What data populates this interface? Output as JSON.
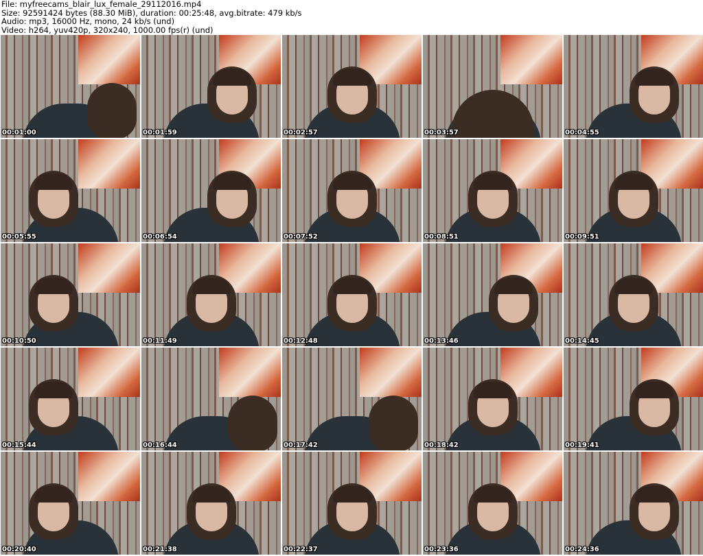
{
  "header": {
    "file": "File: myfreecams_blair_lux_female_29112016.mp4",
    "size": "Size: 92591424 bytes (88.30 MiB), duration: 00:25:48, avg.bitrate: 479 kb/s",
    "audio": "Audio: mp3, 16000 Hz, mono, 24 kb/s (und)",
    "video": "Video: h264, yuv420p, 320x240, 1000.00 fps(r) (und)"
  },
  "thumbnails": [
    {
      "timestamp": "00:01:00"
    },
    {
      "timestamp": "00:01:59"
    },
    {
      "timestamp": "00:02:57"
    },
    {
      "timestamp": "00:03:57"
    },
    {
      "timestamp": "00:04:55"
    },
    {
      "timestamp": "00:05:55"
    },
    {
      "timestamp": "00:06:54"
    },
    {
      "timestamp": "00:07:52"
    },
    {
      "timestamp": "00:08:51"
    },
    {
      "timestamp": "00:09:51"
    },
    {
      "timestamp": "00:10:50"
    },
    {
      "timestamp": "00:11:49"
    },
    {
      "timestamp": "00:12:48"
    },
    {
      "timestamp": "00:13:46"
    },
    {
      "timestamp": "00:14:45"
    },
    {
      "timestamp": "00:15:44"
    },
    {
      "timestamp": "00:16:44"
    },
    {
      "timestamp": "00:17:42"
    },
    {
      "timestamp": "00:18:42"
    },
    {
      "timestamp": "00:19:41"
    },
    {
      "timestamp": "00:20:40"
    },
    {
      "timestamp": "00:21:38"
    },
    {
      "timestamp": "00:22:37"
    },
    {
      "timestamp": "00:23:36"
    },
    {
      "timestamp": "00:24:36"
    }
  ],
  "colors": {
    "background": "#ffffff",
    "header_text": "#000000",
    "timestamp_text": "#ffffff",
    "timestamp_outline": "#000000"
  }
}
